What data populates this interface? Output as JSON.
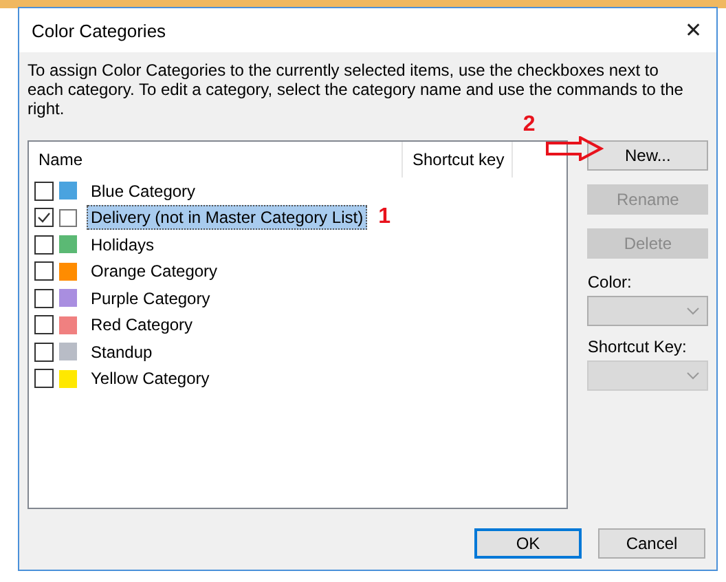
{
  "window": {
    "title": "Color Categories",
    "close": "✕"
  },
  "description": "To assign Color Categories to the currently selected items, use the checkboxes next to each category.  To edit a category, select the category name and use the commands to the right.",
  "columns": [
    "Name",
    "Shortcut key"
  ],
  "categories": [
    {
      "name": "Blue Category",
      "checked": false,
      "selected": false,
      "color": "#4aa3df"
    },
    {
      "name": "Delivery (not in Master Category List)",
      "checked": true,
      "selected": true,
      "color": "#ffffff"
    },
    {
      "name": "Holidays",
      "checked": false,
      "selected": false,
      "color": "#5bb974"
    },
    {
      "name": "Orange Category",
      "checked": false,
      "selected": false,
      "color": "#ff8c00"
    },
    {
      "name": "Purple Category",
      "checked": false,
      "selected": false,
      "color": "#a98ee0"
    },
    {
      "name": "Red Category",
      "checked": false,
      "selected": false,
      "color": "#f08080"
    },
    {
      "name": "Standup",
      "checked": false,
      "selected": false,
      "color": "#b8bcc6"
    },
    {
      "name": "Yellow Category",
      "checked": false,
      "selected": false,
      "color": "#ffe800"
    }
  ],
  "side_buttons": [
    {
      "label": "New...",
      "disabled": false
    },
    {
      "label": "Rename",
      "disabled": true
    },
    {
      "label": "Delete",
      "disabled": true
    }
  ],
  "color_label": "Color:",
  "shortcut_label": "Shortcut Key:",
  "annotations": [
    "1",
    "2"
  ],
  "footer_buttons": [
    {
      "label": "OK",
      "default": true
    },
    {
      "label": "Cancel",
      "default": false
    }
  ]
}
